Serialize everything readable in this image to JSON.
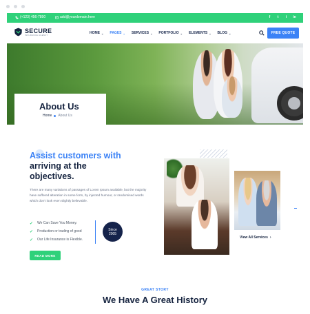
{
  "topbar": {
    "phone": "(+123) 456-7890",
    "email": "add@yourdomain.here",
    "socials": [
      "f",
      "t",
      "i",
      "in"
    ]
  },
  "header": {
    "logo_main": "SECURE",
    "logo_tagline": "INSURANCE AGENCY",
    "nav": [
      {
        "label": "HOME",
        "active": false
      },
      {
        "label": "PAGES",
        "active": true
      },
      {
        "label": "SERVICES",
        "active": false
      },
      {
        "label": "PORTFOLIO",
        "active": false
      },
      {
        "label": "ELEMENTS",
        "active": false
      },
      {
        "label": "BLOG",
        "active": false
      }
    ],
    "cta": "FREE QUOTE"
  },
  "hero": {
    "title": "About Us",
    "breadcrumb_home": "Home",
    "breadcrumb_current": "About Us"
  },
  "about": {
    "headline_line1": "Assist customers with",
    "headline_line2": "arriving at the",
    "headline_line3": "objectives.",
    "paragraph": "There are many variations of passages of Lorem Ipsum available, but the majority have suffered alteration in some form, by injected humour, or randomised words which don't look even slightly believable.",
    "checklist": [
      "We Can Save You Money.",
      "Production or trading of good",
      "Our Life Insurance is Flexible."
    ],
    "since_label": "Since",
    "since_year": "2005",
    "read_more": "READ MORE",
    "services_link": "View All Services"
  },
  "story": {
    "eyebrow": "GREAT STORY",
    "title": "We Have A Great History"
  },
  "colors": {
    "green": "#2fd17a",
    "blue": "#3b82f6",
    "navy": "#15233f"
  }
}
